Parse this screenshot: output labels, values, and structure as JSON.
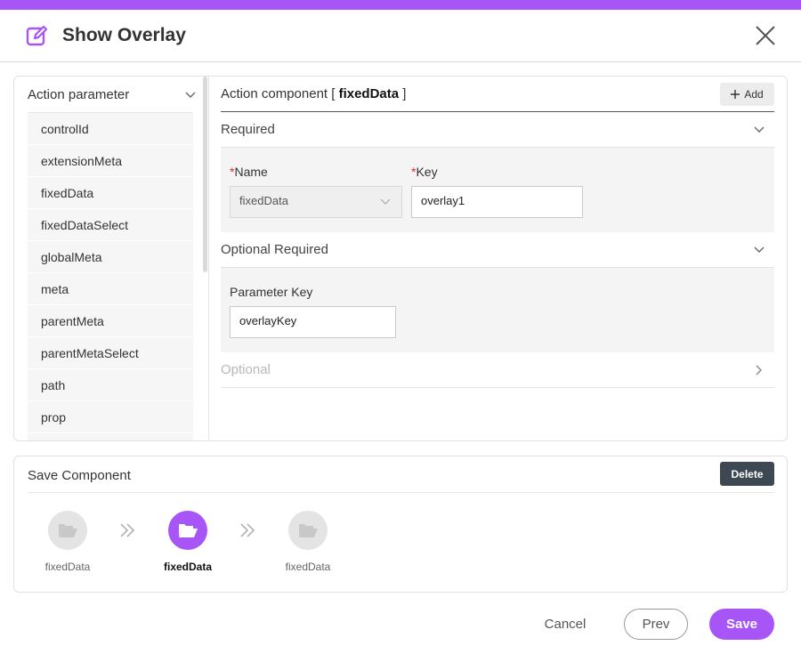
{
  "colors": {
    "accent": "#a855f7",
    "delete_button": "#3d4853",
    "required_mark": "#d32f2f"
  },
  "dialog": {
    "title": "Show Overlay",
    "edit_icon": "edit-icon",
    "close_icon": "close-icon"
  },
  "action_parameter": {
    "label": "Action parameter",
    "items": [
      "controlId",
      "extensionMeta",
      "fixedData",
      "fixedDataSelect",
      "globalMeta",
      "meta",
      "parentMeta",
      "parentMetaSelect",
      "path",
      "prop"
    ]
  },
  "action_component": {
    "prefix": "Action component [ ",
    "name": "fixedData",
    "suffix": " ]",
    "add_label": "Add"
  },
  "required": {
    "title": "Required",
    "name_label": "Name",
    "name_value": "fixedData",
    "key_label": "Key",
    "key_value": "overlay1",
    "required_mark": "*"
  },
  "optional_required": {
    "title": "Optional Required",
    "param_key_label": "Parameter Key",
    "param_key_value": "overlayKey"
  },
  "optional": {
    "title": "Optional"
  },
  "save_component": {
    "title": "Save Component",
    "delete_label": "Delete",
    "steps": [
      {
        "label": "fixedData",
        "active": false
      },
      {
        "label": "fixedData",
        "active": true
      },
      {
        "label": "fixedData",
        "active": false
      }
    ]
  },
  "footer": {
    "cancel_label": "Cancel",
    "prev_label": "Prev",
    "save_label": "Save"
  }
}
